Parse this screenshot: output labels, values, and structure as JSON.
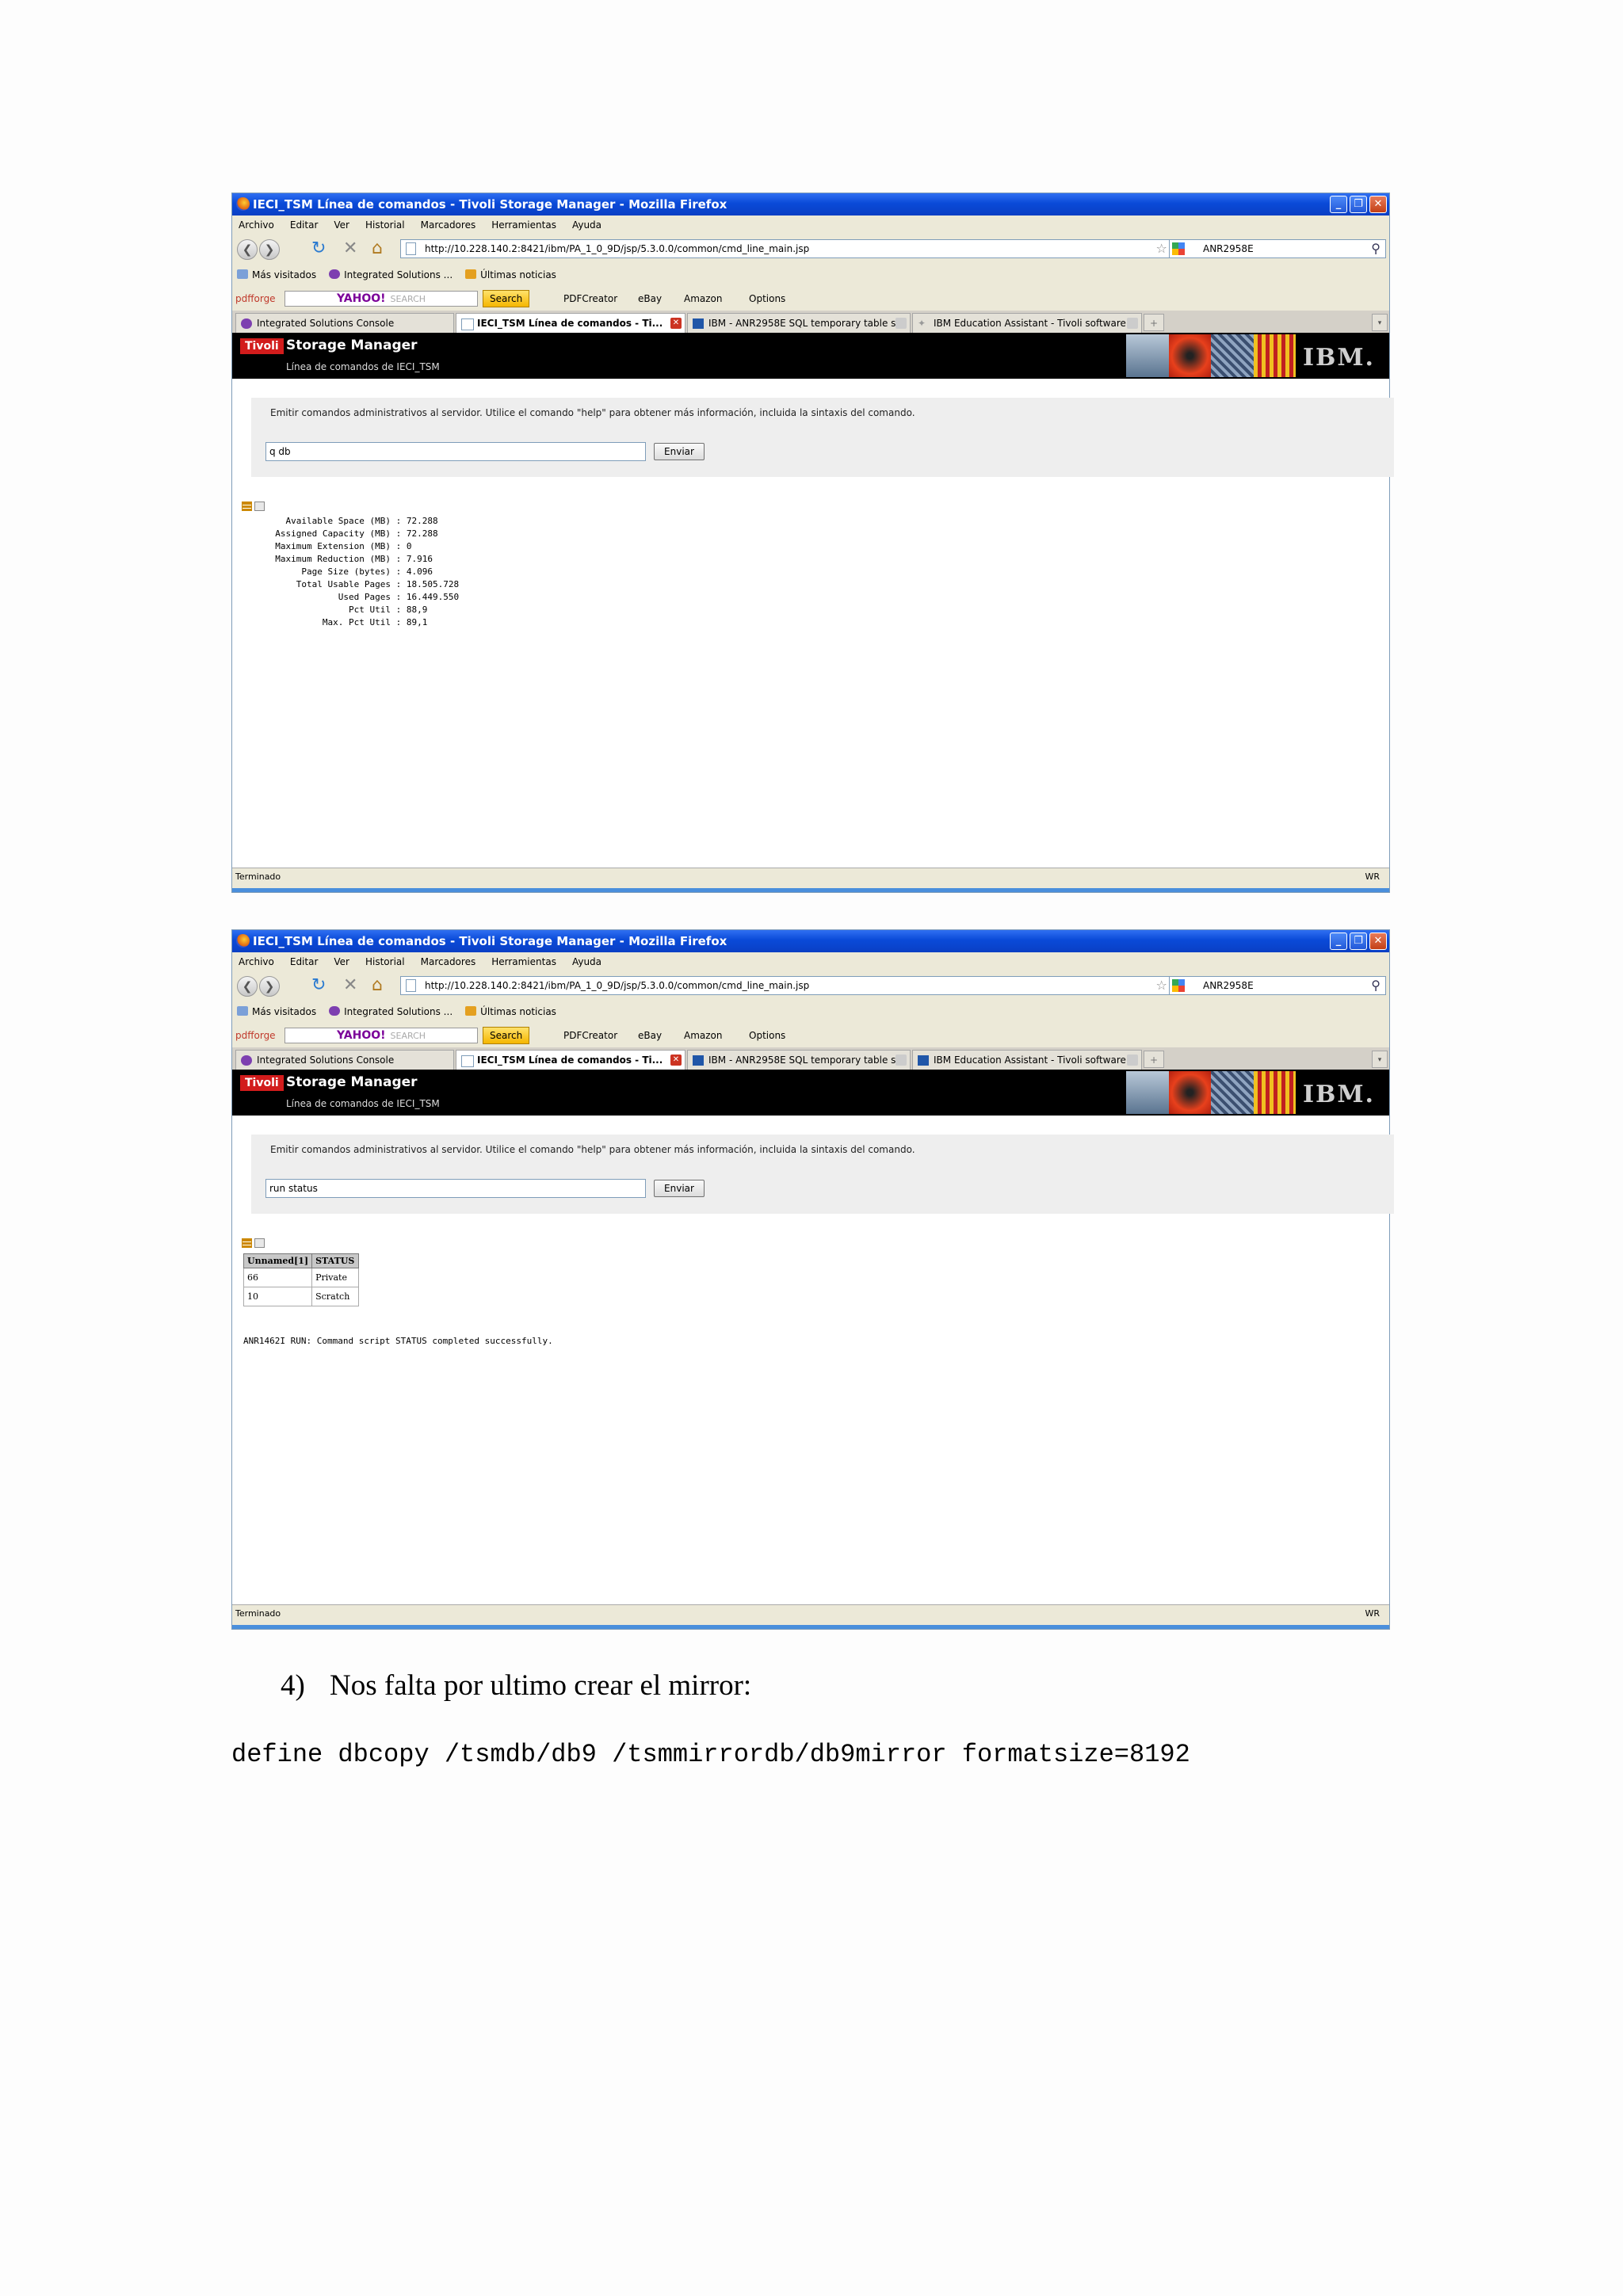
{
  "browser": {
    "title": "IECI_TSM Línea de comandos - Tivoli Storage Manager - Mozilla Firefox",
    "menu": [
      "Archivo",
      "Editar",
      "Ver",
      "Historial",
      "Marcadores",
      "Herramientas",
      "Ayuda"
    ],
    "url": "http://10.228.140.2:8421/ibm/PA_1_0_9D/jsp/5.3.0.0/common/cmd_line_main.jsp",
    "search_value": "ANR2958E",
    "bookmarks": [
      "Más visitados",
      "Integrated Solutions ...",
      "Últimas noticias"
    ],
    "pdf_toolbar": {
      "pdfforge": "pdfforge",
      "yahoo": "YAHOO!",
      "yahoo_search": "SEARCH",
      "search_button": "Search",
      "pdfcreator": "PDFCreator",
      "ebay": "eBay",
      "amazon": "Amazon",
      "options": "Options"
    },
    "tabs": [
      "Integrated Solutions Console",
      "IECI_TSM Línea de comandos - Ti...",
      "IBM - ANR2958E SQL temporary table s...",
      "IBM Education Assistant - Tivoli software"
    ],
    "status_left": "Terminado",
    "status_right": "WR"
  },
  "app": {
    "tivoli": "Tivoli",
    "product": "Storage Manager",
    "subtitle": "Línea de comandos de IECI_TSM",
    "ibm_logo": "IBM.",
    "instruction": "Emitir comandos administrativos al servidor. Utilice el comando \"help\" para obtener más información, incluida la sintaxis del comando.",
    "submit_label": "Enviar"
  },
  "screen1": {
    "command": "q db",
    "rows": [
      {
        "label": "Available Space (MB)",
        "value": "72.288"
      },
      {
        "label": "Assigned Capacity (MB)",
        "value": "72.288"
      },
      {
        "label": "Maximum Extension (MB)",
        "value": "0"
      },
      {
        "label": "Maximum Reduction (MB)",
        "value": "7.916"
      },
      {
        "label": "Page Size (bytes)",
        "value": "4.096"
      },
      {
        "label": "Total Usable Pages",
        "value": "18.505.728"
      },
      {
        "label": "Used Pages",
        "value": "16.449.550"
      },
      {
        "label": "Pct Util",
        "value": "88,9"
      },
      {
        "label": "Max. Pct Util",
        "value": "89,1"
      }
    ]
  },
  "screen2": {
    "command": "run status",
    "table": {
      "headers": [
        "Unnamed[1]",
        "STATUS"
      ],
      "rows": [
        [
          "66",
          "Private"
        ],
        [
          "10",
          "Scratch"
        ]
      ]
    },
    "message": "ANR1462I RUN: Command script STATUS completed successfully."
  },
  "document": {
    "step_number": "4)",
    "step_text": "Nos falta por ultimo crear el mirror:",
    "code": "define dbcopy /tsmdb/db9 /tsmmirrordb/db9mirror formatsize=8192"
  }
}
